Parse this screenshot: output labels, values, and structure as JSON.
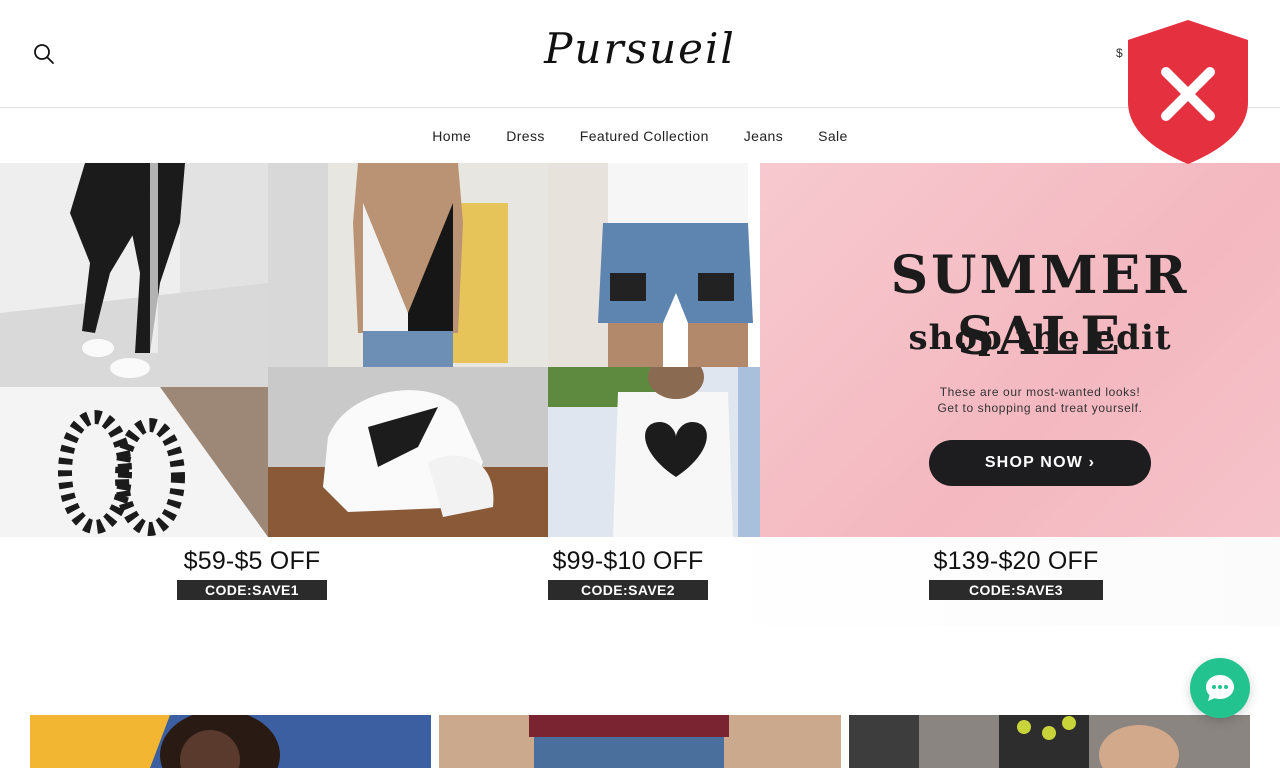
{
  "header": {
    "logo": "Pursueil",
    "currency": "$",
    "icons": {
      "search": "search-icon"
    }
  },
  "nav": {
    "items": [
      {
        "label": "Home"
      },
      {
        "label": "Dress"
      },
      {
        "label": "Featured Collection"
      },
      {
        "label": "Jeans"
      },
      {
        "label": "Sale"
      }
    ]
  },
  "hero": {
    "title": "SUMMER SALE",
    "subtitle": "shop the edit",
    "description_line1": "These are our most-wanted looks!",
    "description_line2": "Get to shopping and treat yourself.",
    "cta": "SHOP NOW ›",
    "offers": [
      {
        "price": "$59-$5 OFF",
        "code": "CODE:SAVE1"
      },
      {
        "price": "$99-$10 OFF",
        "code": "CODE:SAVE2"
      },
      {
        "price": "$139-$20 OFF",
        "code": "CODE:SAVE3"
      }
    ],
    "images": [
      "checkered-leggings-image",
      "checkered-tank-top-image",
      "checkered-denim-shorts-image",
      "checkered-hoop-earrings-image",
      "checkered-sneakers-image",
      "heart-tank-top-image"
    ],
    "colors": {
      "pink_panel": "#f4b8c0",
      "button": "#1d1d1f",
      "code_bar": "#2b2b2b"
    }
  },
  "overlay": {
    "security_badge_icon": "shield-x-icon",
    "security_badge_color": "#e5303f",
    "chat_icon": "chat-bubble-icon",
    "chat_color": "#22c38e"
  }
}
